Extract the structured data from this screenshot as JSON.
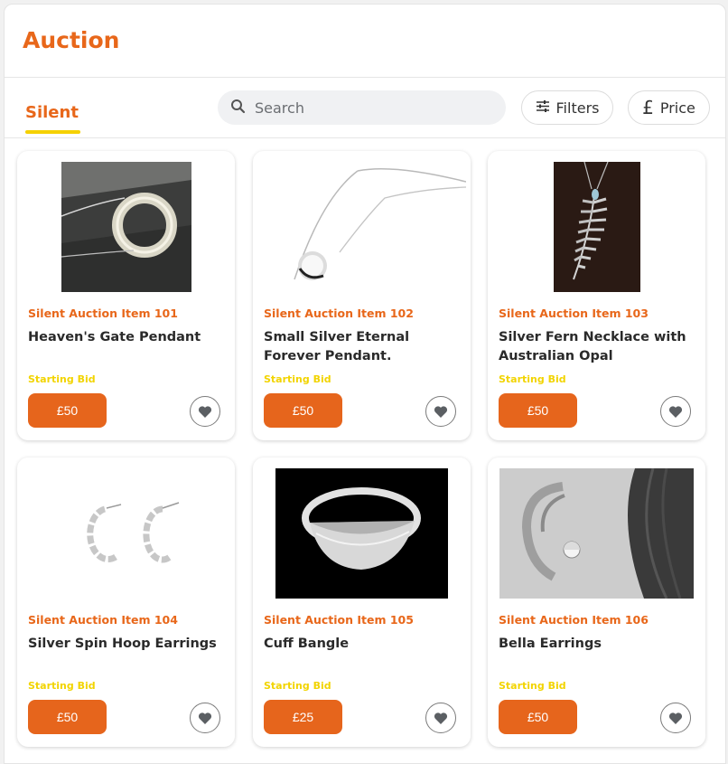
{
  "header": {
    "title": "Auction"
  },
  "tabs": [
    {
      "label": "Silent",
      "active": true
    }
  ],
  "search": {
    "placeholder": "Search",
    "value": ""
  },
  "filters": {
    "label": "Filters",
    "icon": "sliders-icon"
  },
  "price": {
    "label": "Price",
    "icon": "pound-icon"
  },
  "colors": {
    "accent": "#e8671a",
    "button": "#e6651c",
    "highlight": "#f5d100"
  },
  "items": [
    {
      "lot": "Silent Auction Item 101",
      "name": "Heaven's Gate Pendant",
      "bid_label": "Starting Bid",
      "price": "£50",
      "image": "ring-pendant-photo"
    },
    {
      "lot": "Silent Auction Item 102",
      "name": "Small Silver Eternal Forever Pendant.",
      "bid_label": "Starting Bid",
      "price": "£50",
      "image": "silver-pendant-photo"
    },
    {
      "lot": "Silent Auction Item 103",
      "name": "Silver Fern Necklace with Australian Opal",
      "bid_label": "Starting Bid",
      "price": "£50",
      "image": "fern-necklace-photo"
    },
    {
      "lot": "Silent Auction Item 104",
      "name": "Silver Spin Hoop Earrings",
      "bid_label": "Starting Bid",
      "price": "£50",
      "image": "hoop-earrings-photo"
    },
    {
      "lot": "Silent Auction Item 105",
      "name": "Cuff Bangle",
      "bid_label": "Starting Bid",
      "price": "£25",
      "image": "cuff-bangle-photo"
    },
    {
      "lot": "Silent Auction Item 106",
      "name": "Bella Earrings",
      "bid_label": "Starting Bid",
      "price": "£50",
      "image": "ear-earring-photo"
    }
  ]
}
